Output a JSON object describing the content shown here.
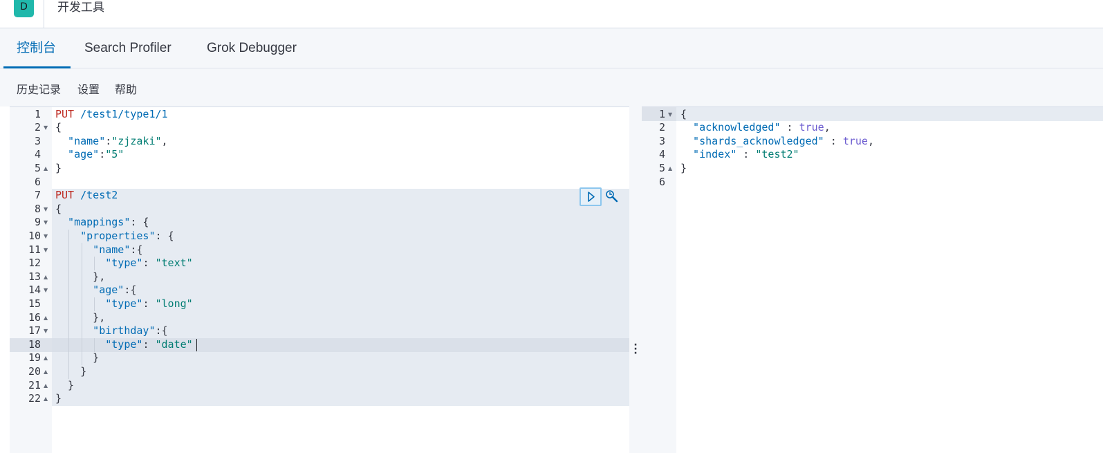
{
  "header": {
    "logo_letter": "D",
    "title": "开发工具"
  },
  "tabs": [
    {
      "label": "控制台",
      "active": true
    },
    {
      "label": "Search Profiler",
      "active": false
    },
    {
      "label": "Grok Debugger",
      "active": false
    }
  ],
  "toolbar": {
    "history": "历史记录",
    "settings": "设置",
    "help": "帮助"
  },
  "request_editor": {
    "line_numbers": [
      "1",
      "2",
      "3",
      "4",
      "5",
      "6",
      "7",
      "8",
      "9",
      "10",
      "11",
      "12",
      "13",
      "14",
      "15",
      "16",
      "17",
      "18",
      "19",
      "20",
      "21",
      "22"
    ],
    "active_line": 18,
    "lines": [
      {
        "tokens": [
          {
            "t": "PUT",
            "c": "kw"
          },
          {
            "t": " /test1/type1/1",
            "c": "url"
          }
        ]
      },
      {
        "tokens": [
          {
            "t": "{",
            "c": "punct"
          }
        ]
      },
      {
        "tokens": [
          {
            "t": "  \"name\"",
            "c": "key"
          },
          {
            "t": ":",
            "c": "punct"
          },
          {
            "t": "\"zjzaki\"",
            "c": "str"
          },
          {
            "t": ",",
            "c": "punct"
          }
        ]
      },
      {
        "tokens": [
          {
            "t": "  \"age\"",
            "c": "key"
          },
          {
            "t": ":",
            "c": "punct"
          },
          {
            "t": "\"5\"",
            "c": "str"
          }
        ]
      },
      {
        "tokens": [
          {
            "t": "}",
            "c": "punct"
          }
        ]
      },
      {
        "tokens": []
      },
      {
        "tokens": [
          {
            "t": "PUT",
            "c": "kw"
          },
          {
            "t": " /test2",
            "c": "url"
          }
        ]
      },
      {
        "tokens": [
          {
            "t": "{",
            "c": "punct"
          }
        ]
      },
      {
        "tokens": [
          {
            "t": "  \"mappings\"",
            "c": "key"
          },
          {
            "t": ": {",
            "c": "punct"
          }
        ]
      },
      {
        "tokens": [
          {
            "t": "    \"properties\"",
            "c": "key"
          },
          {
            "t": ": {",
            "c": "punct"
          }
        ]
      },
      {
        "tokens": [
          {
            "t": "      \"name\"",
            "c": "key"
          },
          {
            "t": ":{",
            "c": "punct"
          }
        ]
      },
      {
        "tokens": [
          {
            "t": "        \"type\"",
            "c": "key"
          },
          {
            "t": ": ",
            "c": "punct"
          },
          {
            "t": "\"text\"",
            "c": "str"
          }
        ]
      },
      {
        "tokens": [
          {
            "t": "      },",
            "c": "punct"
          }
        ]
      },
      {
        "tokens": [
          {
            "t": "      \"age\"",
            "c": "key"
          },
          {
            "t": ":{",
            "c": "punct"
          }
        ]
      },
      {
        "tokens": [
          {
            "t": "        \"type\"",
            "c": "key"
          },
          {
            "t": ": ",
            "c": "punct"
          },
          {
            "t": "\"long\"",
            "c": "str"
          }
        ]
      },
      {
        "tokens": [
          {
            "t": "      },",
            "c": "punct"
          }
        ]
      },
      {
        "tokens": [
          {
            "t": "      \"birthday\"",
            "c": "key"
          },
          {
            "t": ":{",
            "c": "punct"
          }
        ]
      },
      {
        "tokens": [
          {
            "t": "        \"type\"",
            "c": "key"
          },
          {
            "t": ": ",
            "c": "punct"
          },
          {
            "t": "\"date\"",
            "c": "str"
          }
        ]
      },
      {
        "tokens": [
          {
            "t": "      }",
            "c": "punct"
          }
        ]
      },
      {
        "tokens": [
          {
            "t": "    }",
            "c": "punct"
          }
        ]
      },
      {
        "tokens": [
          {
            "t": "  }",
            "c": "punct"
          }
        ]
      },
      {
        "tokens": [
          {
            "t": "}",
            "c": "punct"
          }
        ]
      }
    ],
    "fold_markers": {
      "2": "down",
      "5": "up",
      "8": "down",
      "9": "down",
      "10": "down",
      "11": "down",
      "13": "up",
      "14": "down",
      "16": "up",
      "17": "down",
      "19": "up",
      "20": "up",
      "21": "up",
      "22": "up"
    }
  },
  "response_editor": {
    "line_numbers": [
      "1",
      "2",
      "3",
      "4",
      "5",
      "6"
    ],
    "lines": [
      {
        "tokens": [
          {
            "t": "{",
            "c": "punct"
          }
        ]
      },
      {
        "tokens": [
          {
            "t": "  \"acknowledged\"",
            "c": "key"
          },
          {
            "t": " : ",
            "c": "punct"
          },
          {
            "t": "true",
            "c": "bool"
          },
          {
            "t": ",",
            "c": "punct"
          }
        ]
      },
      {
        "tokens": [
          {
            "t": "  \"shards_acknowledged\"",
            "c": "key"
          },
          {
            "t": " : ",
            "c": "punct"
          },
          {
            "t": "true",
            "c": "bool"
          },
          {
            "t": ",",
            "c": "punct"
          }
        ]
      },
      {
        "tokens": [
          {
            "t": "  \"index\"",
            "c": "key"
          },
          {
            "t": " : ",
            "c": "punct"
          },
          {
            "t": "\"test2\"",
            "c": "str"
          }
        ]
      },
      {
        "tokens": [
          {
            "t": "}",
            "c": "punct"
          }
        ]
      },
      {
        "tokens": []
      }
    ],
    "fold_markers": {
      "1": "down",
      "5": "up"
    }
  },
  "icons": {
    "play": "play-icon",
    "wrench": "wrench-icon",
    "splitter": "vertical-dots-icon"
  },
  "colors": {
    "accent": "#006bb4",
    "logo": "#20b8ab",
    "method": "#bd271e",
    "string": "#017d73",
    "selection": "#e6ebf2"
  }
}
